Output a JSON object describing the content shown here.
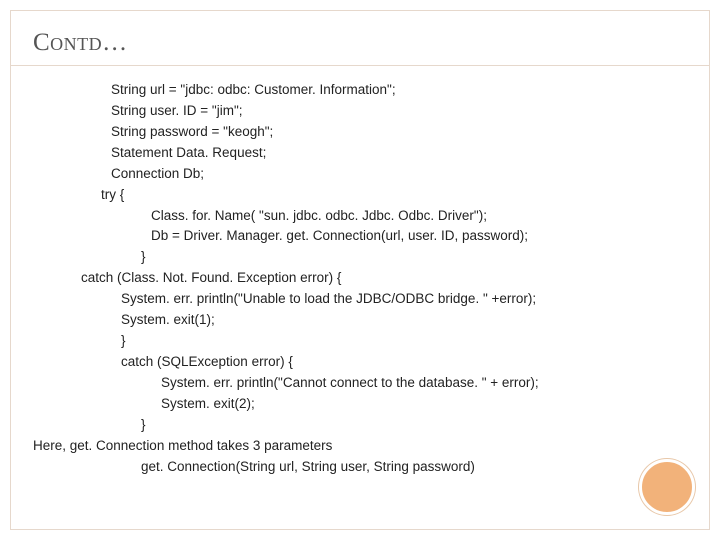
{
  "title": "Contd…",
  "code": {
    "l1": "String url = \"jdbc: odbc: Customer. Information\";",
    "l2": "String user. ID = \"jim\";",
    "l3": "String password = \"keogh\";",
    "l4": "Statement Data. Request;",
    "l5": "Connection Db;",
    "l6": "try {",
    "l7": "Class. for. Name( \"sun. jdbc. odbc. Jdbc. Odbc. Driver\");",
    "l8": "Db = Driver. Manager. get. Connection(url, user. ID, password);",
    "l9": "}",
    "l10": "catch (Class. Not. Found. Exception error) {",
    "l11": "System. err. println(\"Unable to load the JDBC/ODBC bridge. \" +error);",
    "l12": "System. exit(1);",
    "l13": "}",
    "l14": "catch (SQLException error) {",
    "l15": "System. err. println(\"Cannot connect to the database. \" + error);",
    "l16": "System. exit(2);",
    "l17": "}",
    "l18": "Here, get. Connection method takes 3 parameters",
    "l19": "get. Connection(String url, String user, String password)"
  }
}
